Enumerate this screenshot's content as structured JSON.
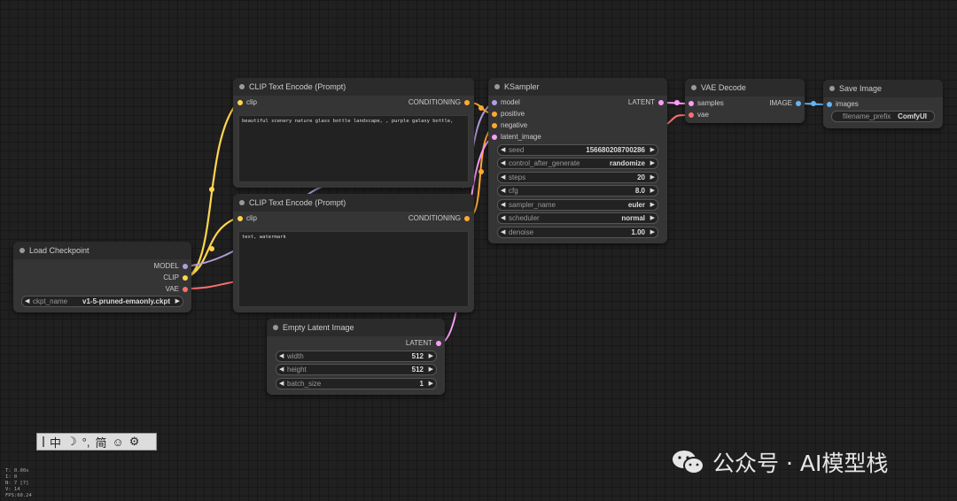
{
  "nodes": {
    "clip1": {
      "title": "CLIP Text Encode (Prompt)",
      "input": "clip",
      "output": "CONDITIONING",
      "text": "beautiful scenery nature glass bottle landscape, , purple galaxy bottle,"
    },
    "clip2": {
      "title": "CLIP Text Encode (Prompt)",
      "input": "clip",
      "output": "CONDITIONING",
      "text": "text, watermark"
    },
    "ksampler": {
      "title": "KSampler",
      "inputs": [
        "model",
        "positive",
        "negative",
        "latent_image"
      ],
      "output": "LATENT",
      "widgets": [
        {
          "label": "seed",
          "value": "156680208700286"
        },
        {
          "label": "control_after_generate",
          "value": "randomize"
        },
        {
          "label": "steps",
          "value": "20"
        },
        {
          "label": "cfg",
          "value": "8.0"
        },
        {
          "label": "sampler_name",
          "value": "euler"
        },
        {
          "label": "scheduler",
          "value": "normal"
        },
        {
          "label": "denoise",
          "value": "1.00"
        }
      ]
    },
    "vae_decode": {
      "title": "VAE Decode",
      "inputs": [
        "samples",
        "vae"
      ],
      "output": "IMAGE"
    },
    "save_image": {
      "title": "Save Image",
      "input": "images",
      "widget": {
        "label": "filename_prefix",
        "value": "ComfyUI"
      }
    },
    "load_checkpoint": {
      "title": "Load Checkpoint",
      "outputs": [
        "MODEL",
        "CLIP",
        "VAE"
      ],
      "widget": {
        "label": "ckpt_name",
        "value": "v1-5-pruned-emaonly.ckpt"
      }
    },
    "empty_latent": {
      "title": "Empty Latent Image",
      "output": "LATENT",
      "widgets": [
        {
          "label": "width",
          "value": "512"
        },
        {
          "label": "height",
          "value": "512"
        },
        {
          "label": "batch_size",
          "value": "1"
        }
      ]
    }
  },
  "toolbar": {
    "items": [
      "中",
      "☽",
      "°,",
      "简",
      "☺",
      "⚙"
    ]
  },
  "stats": [
    "T: 0.00s",
    "I: 0",
    "N: 7 [7]",
    "V: 14",
    "FPS:60.24"
  ],
  "watermark": {
    "text": "公众号 · AI模型栈"
  },
  "colors": {
    "model": "#b39ddb",
    "clip": "#ffd54f",
    "vae": "#ff6e6e",
    "conditioning": "#ffa931",
    "latent": "#ff9cf9",
    "image": "#64b5f6"
  }
}
